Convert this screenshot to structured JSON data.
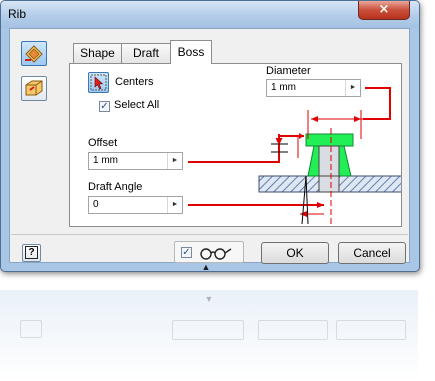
{
  "window": {
    "title": "Rib",
    "close_glyph": "×"
  },
  "tabs": [
    {
      "label": "Shape"
    },
    {
      "label": "Draft"
    },
    {
      "label": "Boss"
    }
  ],
  "boss": {
    "centers_label": "Centers",
    "select_all_label": "Select All",
    "select_all_checked": true,
    "diameter_label": "Diameter",
    "diameter_value": "1 mm",
    "offset_label": "Offset",
    "offset_value": "1 mm",
    "draft_angle_label": "Draft Angle",
    "draft_angle_value": "0"
  },
  "footer": {
    "help_glyph": "?",
    "preview_checked": true,
    "ok_label": "OK",
    "cancel_label": "Cancel",
    "expand_glyph": "▲"
  },
  "colors": {
    "accent_red": "#e00000",
    "boss_green": "#22ee55",
    "hatch_blue": "#5f7faa"
  }
}
